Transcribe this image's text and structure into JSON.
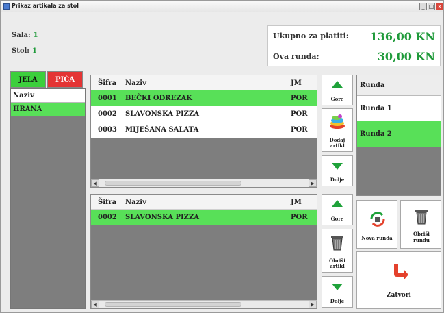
{
  "window": {
    "title": "Prikaz artikala za stol"
  },
  "info": {
    "sala_label": "Sala:",
    "sala_value": "1",
    "stol_label": "Stol:",
    "stol_value": "1"
  },
  "totals": {
    "ukupno_label": "Ukupno za platiti:",
    "ukupno_value": "136,00 KN",
    "runda_label": "Ova runda:",
    "runda_value": "30,00 KN"
  },
  "tabs": [
    {
      "label": "JELA",
      "color": "#3ccf3c"
    },
    {
      "label": "PIĆA",
      "color": "#e43434"
    }
  ],
  "left_list": {
    "header": "Naziv",
    "items": [
      "HRANA"
    ]
  },
  "top_table": {
    "headers": [
      "Šifra",
      "Naziv",
      "JM"
    ],
    "rows": [
      {
        "sifra": "0001",
        "naziv": "BEČKI ODREZAK",
        "jm": "POR"
      },
      {
        "sifra": "0002",
        "naziv": "SLAVONSKA PIZZA",
        "jm": "POR"
      },
      {
        "sifra": "0003",
        "naziv": "MIJEŠANA SALATA",
        "jm": "POR"
      }
    ]
  },
  "bottom_table": {
    "headers": [
      "Šifra",
      "Naziv",
      "JM"
    ],
    "rows": [
      {
        "sifra": "0002",
        "naziv": "SLAVONSKA PIZZA",
        "jm": "POR"
      }
    ]
  },
  "buttons": {
    "gore_top": "Gore",
    "dodaj": "Dodaj artikl",
    "dolje_top": "Dolje",
    "gore_bottom": "Gore",
    "obrisi_artikl": "Obriši artikl",
    "dolje_bottom": "Dolje",
    "nova_runda": "Nova runda",
    "obrisi_rundu": "Obriši rundu",
    "zatvori": "Zatvori"
  },
  "runda_list": {
    "header": "Runda",
    "items": [
      "Runda 1",
      "Runda 2"
    ]
  },
  "colors": {
    "accent_green": "#58e058",
    "value_green": "#1f9a3a",
    "close_red": "#e43434"
  }
}
